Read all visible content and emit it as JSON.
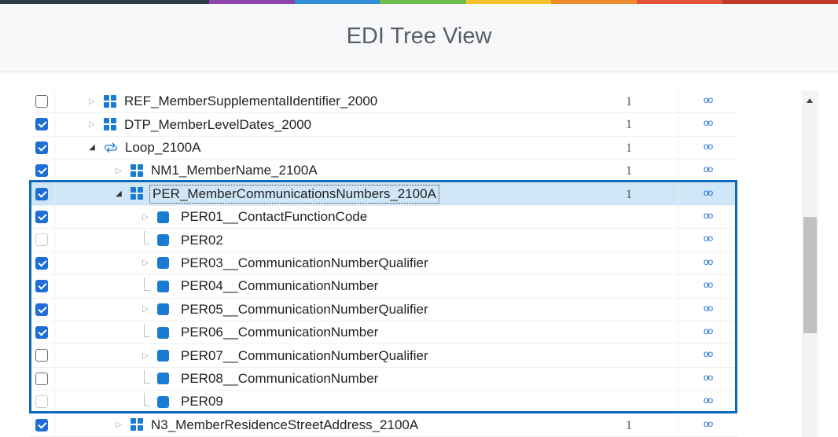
{
  "header": {
    "title": "EDI Tree View"
  },
  "colors": {
    "topbar": [
      "#2d3a4a",
      "#8e44ad",
      "#2f8fd8",
      "#6cc04a",
      "#f3c12b",
      "#f08c2e",
      "#e0533a",
      "#c0392b"
    ],
    "accent": "#0a6bbd",
    "selected_row": "#cfe6f6",
    "icon": "#1a7bd3"
  },
  "rows": [
    {
      "checkbox": "unchecked",
      "expander": "collapsed",
      "icon": "segment-icon",
      "label": "REF_MemberSupplementalIdentifier_2000",
      "count": "1",
      "link": "oo"
    },
    {
      "checkbox": "checked",
      "expander": "collapsed",
      "icon": "segment-icon",
      "label": "DTP_MemberLevelDates_2000",
      "count": "1",
      "link": "oo"
    },
    {
      "checkbox": "checked",
      "expander": "expanded",
      "icon": "loop-icon",
      "label": "Loop_2100A",
      "count": "1",
      "link": "oo"
    },
    {
      "checkbox": "checked",
      "expander": "collapsed",
      "icon": "segment-icon",
      "label": "NM1_MemberName_2100A",
      "count": "1",
      "link": "oo"
    },
    {
      "checkbox": "checked",
      "expander": "expanded",
      "icon": "segment-icon",
      "label": "PER_MemberCommunicationsNumbers_2100A",
      "count": "1",
      "link": "oo",
      "selected": true
    },
    {
      "checkbox": "checked",
      "expander": "collapsed",
      "icon": "element-icon",
      "label": "PER01__ContactFunctionCode",
      "count": "",
      "link": "oo"
    },
    {
      "checkbox": "disabled",
      "expander": "leaf",
      "icon": "element-icon",
      "label": "PER02",
      "count": "",
      "link": "oo"
    },
    {
      "checkbox": "checked",
      "expander": "collapsed",
      "icon": "element-icon",
      "label": "PER03__CommunicationNumberQualifier",
      "count": "",
      "link": "oo"
    },
    {
      "checkbox": "checked",
      "expander": "leaf",
      "icon": "element-icon",
      "label": "PER04__CommunicationNumber",
      "count": "",
      "link": "oo"
    },
    {
      "checkbox": "checked",
      "expander": "collapsed",
      "icon": "element-icon",
      "label": "PER05__CommunicationNumberQualifier",
      "count": "",
      "link": "oo"
    },
    {
      "checkbox": "checked",
      "expander": "leaf",
      "icon": "element-icon",
      "label": "PER06__CommunicationNumber",
      "count": "",
      "link": "oo"
    },
    {
      "checkbox": "unchecked",
      "expander": "collapsed",
      "icon": "element-icon",
      "label": "PER07__CommunicationNumberQualifier",
      "count": "",
      "link": "oo"
    },
    {
      "checkbox": "unchecked",
      "expander": "leaf",
      "icon": "element-icon",
      "label": "PER08__CommunicationNumber",
      "count": "",
      "link": "oo"
    },
    {
      "checkbox": "disabled",
      "expander": "leaf",
      "icon": "element-icon",
      "label": "PER09",
      "count": "",
      "link": "oo"
    },
    {
      "checkbox": "checked",
      "expander": "collapsed",
      "icon": "segment-icon",
      "label": "N3_MemberResidenceStreetAddress_2100A",
      "count": "1",
      "link": "oo"
    }
  ]
}
